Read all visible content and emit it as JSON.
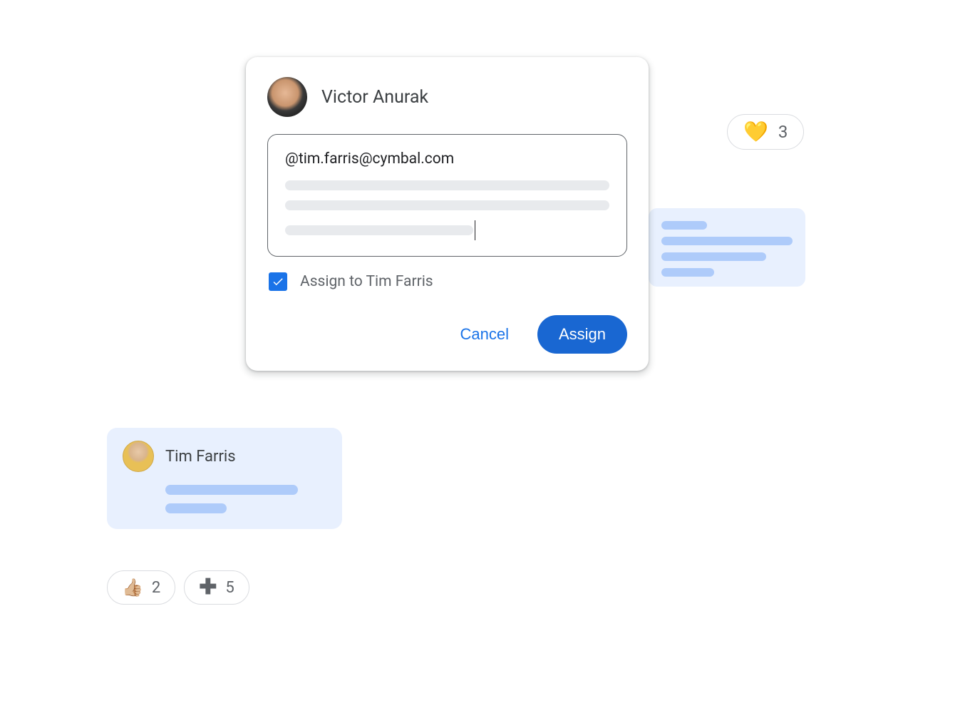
{
  "comment": {
    "author_name": "Victor Anurak",
    "mention_text": "@tim.farris@cymbal.com",
    "assign_checked": true,
    "assign_label": "Assign to Tim Farris",
    "cancel_label": "Cancel",
    "assign_button_label": "Assign"
  },
  "reactions": {
    "heart": {
      "icon": "heart-icon",
      "count": "3"
    },
    "thumbs": {
      "icon": "thumbs-up-icon",
      "count": "2"
    },
    "plus": {
      "icon": "plus-icon",
      "count": "5"
    }
  },
  "tim_card": {
    "name": "Tim Farris"
  }
}
